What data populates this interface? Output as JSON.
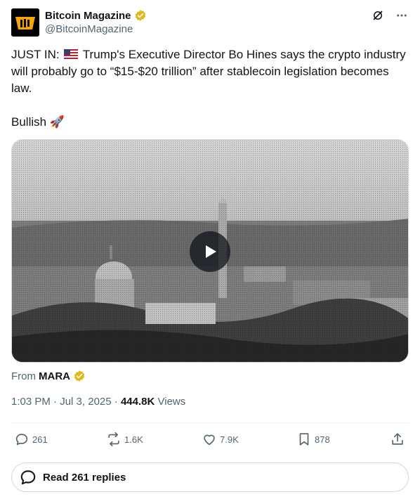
{
  "author": {
    "name": "Bitcoin Magazine",
    "handle": "@BitcoinMagazine",
    "verified_color": "#e2b719"
  },
  "tweet": {
    "prefix": "JUST IN:",
    "body": "Trump's Executive Director Bo Hines says the crypto industry will probably go to “$15-$20 trillion” after stablecoin legislation becomes law.",
    "flag_icon": "us-flag-icon",
    "bullish": "Bullish",
    "rocket": "🚀"
  },
  "media": {
    "type": "video",
    "play_icon": "play-icon",
    "source_prefix": "From",
    "source_name": "MARA"
  },
  "meta": {
    "time": "1:03 PM",
    "date": "Jul 3, 2025",
    "views_count": "444.8K",
    "views_label": "Views"
  },
  "actions": {
    "replies": "261",
    "reposts": "1.6K",
    "likes": "7.9K",
    "bookmarks": "878"
  },
  "read_replies_label": "Read 261 replies",
  "colors": {
    "text": "#0f1419",
    "secondary": "#536471",
    "border": "#cfd9de"
  }
}
